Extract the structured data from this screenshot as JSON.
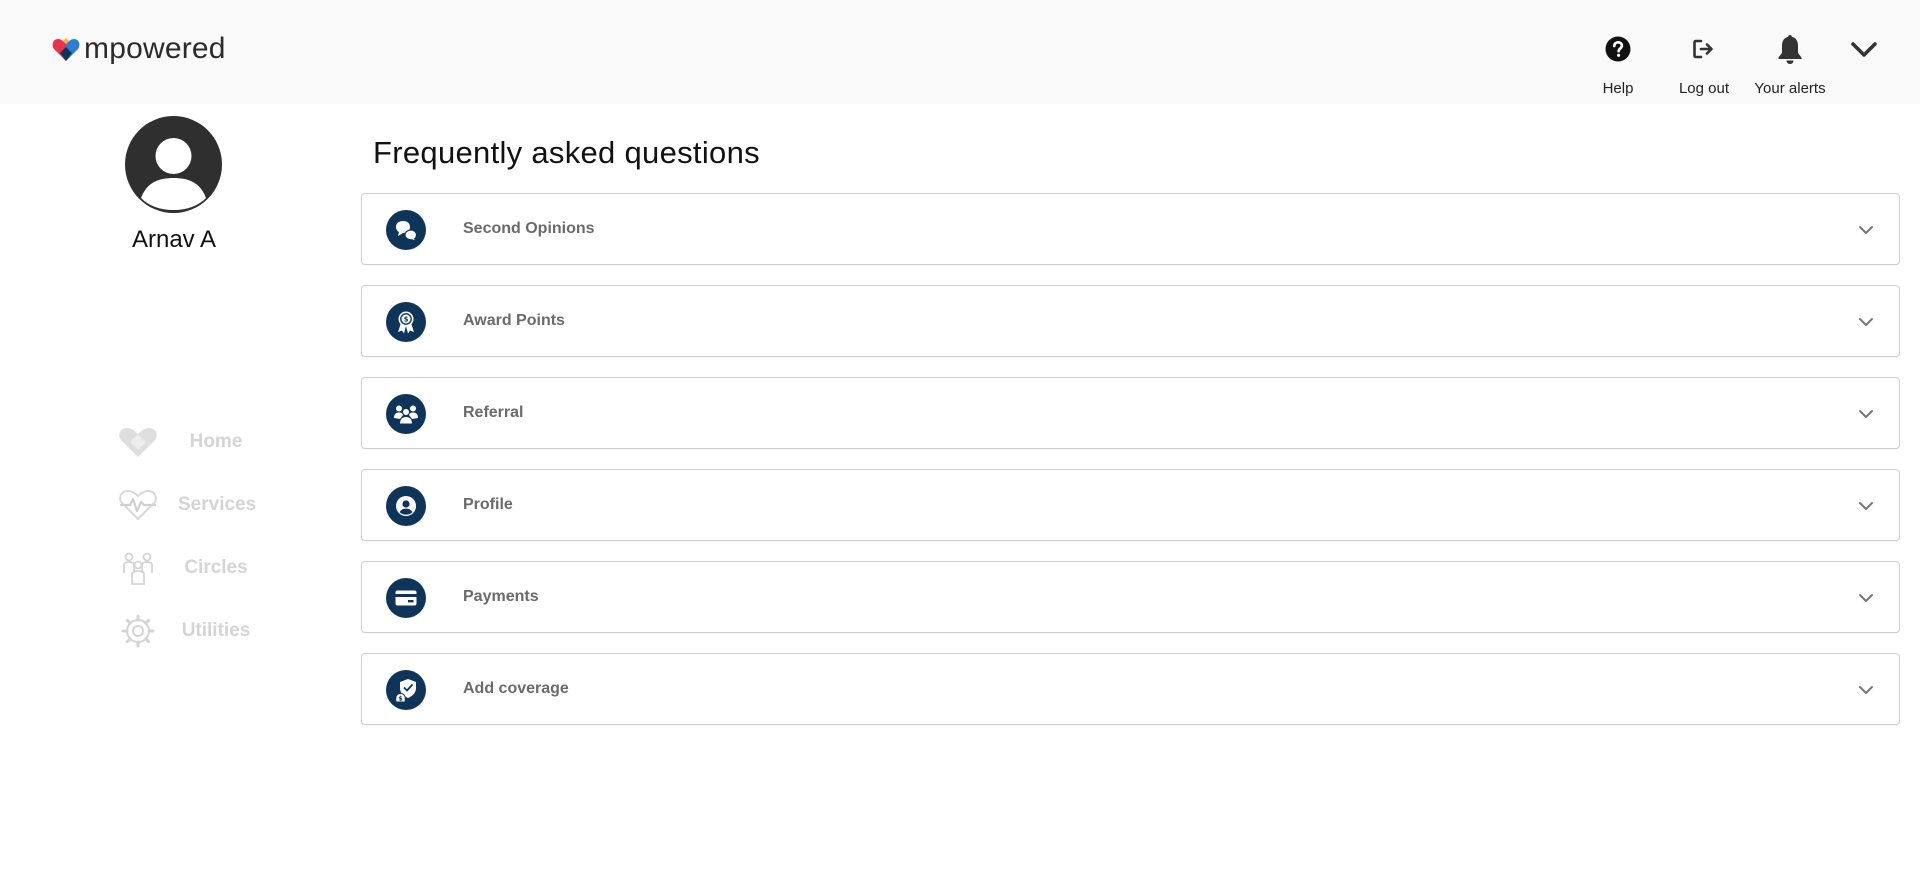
{
  "brand": {
    "name": "mpowered"
  },
  "header": {
    "actions": [
      {
        "id": "help",
        "label": "Help",
        "icon": "help-circle-icon"
      },
      {
        "id": "logout",
        "label": "Log out",
        "icon": "logout-icon"
      },
      {
        "id": "alerts",
        "label": "Your alerts",
        "icon": "bell-icon"
      }
    ],
    "menu_icon": "chevron-down-icon"
  },
  "user": {
    "name": "Arnav A",
    "avatar_icon": "user-avatar-icon"
  },
  "sidebar": {
    "items": [
      {
        "label": "Home",
        "icon": "heart-home-icon"
      },
      {
        "label": "Services",
        "icon": "heartbeat-icon"
      },
      {
        "label": "Circles",
        "icon": "people-icon"
      },
      {
        "label": "Utilities",
        "icon": "gear-icon"
      }
    ]
  },
  "main": {
    "title": "Frequently asked questions",
    "faqs": [
      {
        "label": "Second Opinions",
        "icon": "chat-bubbles-icon"
      },
      {
        "label": "Award Points",
        "icon": "award-ribbon-icon"
      },
      {
        "label": "Referral",
        "icon": "group-icon"
      },
      {
        "label": "Profile",
        "icon": "profile-icon"
      },
      {
        "label": "Payments",
        "icon": "credit-card-icon"
      },
      {
        "label": "Add coverage",
        "icon": "shield-money-icon"
      }
    ]
  },
  "colors": {
    "topbar_bg": "#f9f9f9",
    "faq_icon_bg": "#0e3559",
    "nav_disabled": "#d4d4d4",
    "logo_red": "#e8334a",
    "logo_blue": "#2a7fd4",
    "logo_navy": "#0e3559",
    "logo_yellow": "#f5b82e"
  }
}
